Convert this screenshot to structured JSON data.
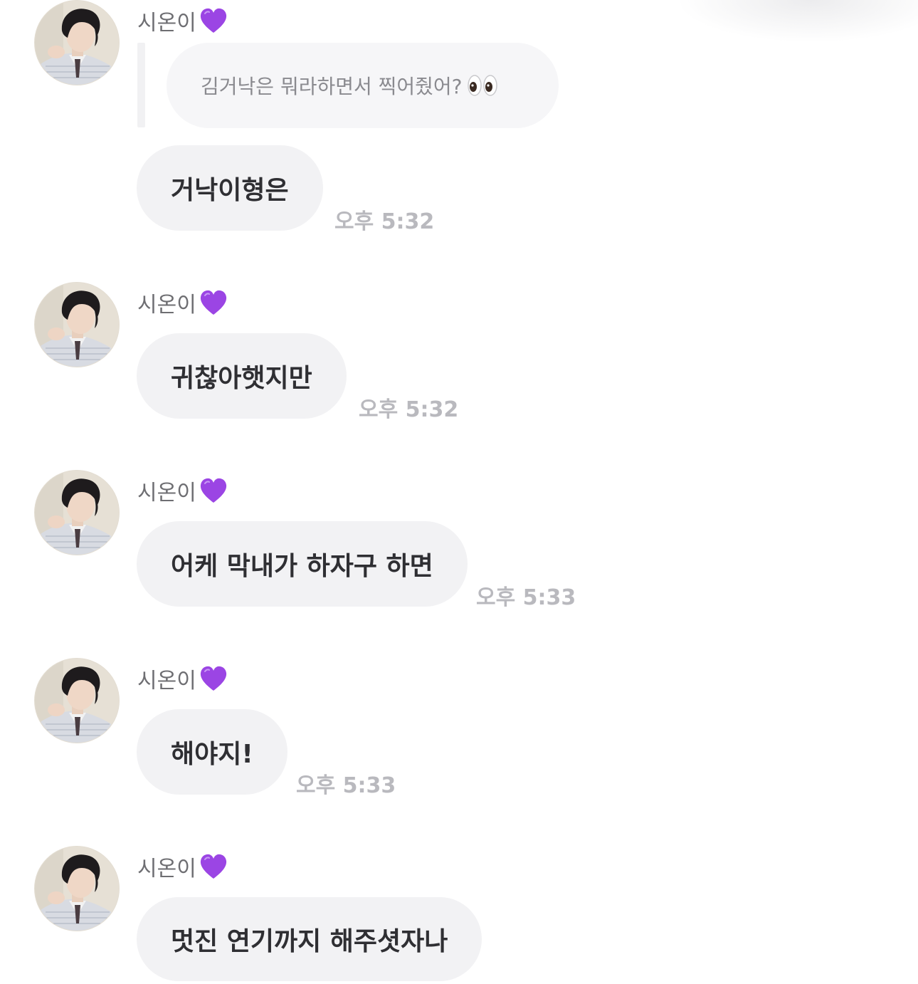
{
  "sender": {
    "name": "시온이",
    "name_emoji": "purple-heart-icon"
  },
  "reply_preview": {
    "text": "김거낙은 뭐라하면서 찍어줬어?",
    "emoji": "eyes-icon"
  },
  "messages": [
    {
      "text": "거낙이형은",
      "time": "오후 5:32"
    },
    {
      "text": "귀찮아햇지만",
      "time": "오후 5:32"
    },
    {
      "text": "어케 막내가 하자구 하면",
      "time": "오후 5:33"
    },
    {
      "text": "해야지!",
      "time": "오후 5:33"
    },
    {
      "text": "멋진 연기까지 해주셧자나",
      "time": ""
    }
  ],
  "colors": {
    "bubble_bg": "#f2f2f4",
    "bubble_text": "#2f2f33",
    "time_text": "#b9b9be",
    "name_text": "#6e6e72",
    "heart": "#9b45e4"
  }
}
